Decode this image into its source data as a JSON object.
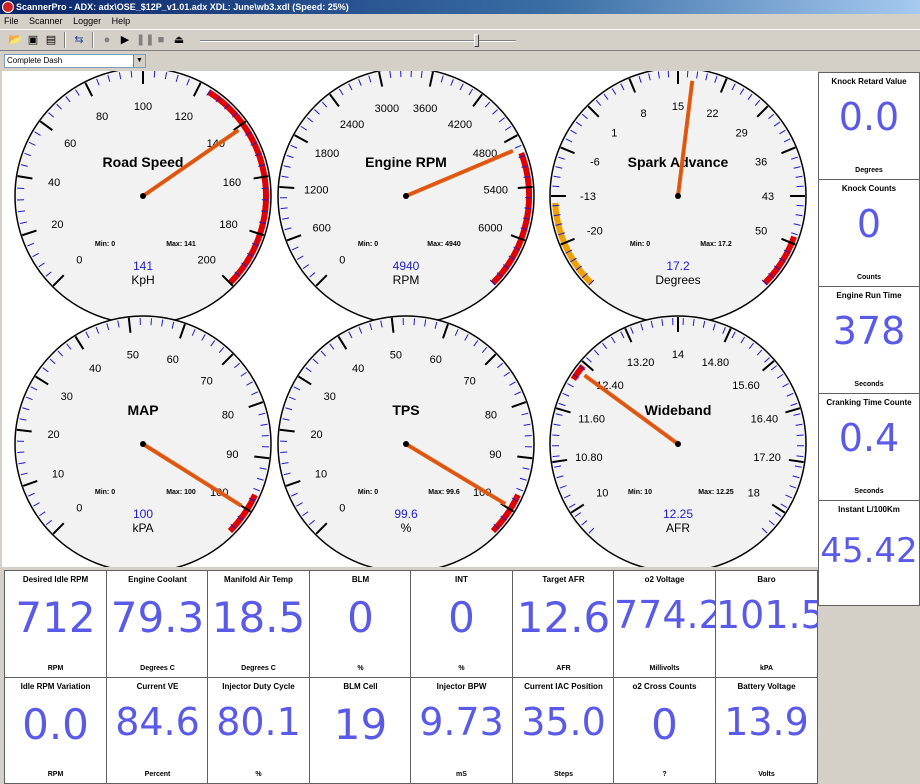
{
  "window": {
    "title": "ScannerPro - ADX: adx\\OSE_$12P_v1.01.adx  XDL: June\\wb3.xdl (Speed: 25%)"
  },
  "menu": {
    "file": "File",
    "scanner": "Scanner",
    "logger": "Logger",
    "help": "Help"
  },
  "toolbar": {
    "playback_speed_percent": 25
  },
  "dashboard_select": {
    "value": "Complete Dash"
  },
  "gauges": [
    {
      "id": "road-speed",
      "title": "Road Speed",
      "min": 0,
      "max": 200,
      "step": 20,
      "labels": [
        0,
        20,
        40,
        60,
        80,
        100,
        120,
        140,
        160,
        180,
        200
      ],
      "value_text": "141",
      "unit": "KpH",
      "min_text": "Min: 0",
      "max_text": "Max: 141",
      "needle": 141,
      "peak": 141,
      "zones": [
        {
          "from": 124,
          "to": 200,
          "color": "#e00000"
        }
      ]
    },
    {
      "id": "engine-rpm",
      "title": "Engine RPM",
      "min": 0,
      "max": 6600,
      "step": 600,
      "labels": [
        0,
        600,
        1200,
        1800,
        2400,
        3000,
        3600,
        4200,
        4800,
        5400,
        6000
      ],
      "value_text": "4940",
      "unit": "RPM",
      "min_text": "Min: 0",
      "max_text": "Max: 4940",
      "needle": 4940,
      "peak": 4940,
      "zones": [
        {
          "from": 5000,
          "to": 6600,
          "color": "#e00000"
        }
      ]
    },
    {
      "id": "spark-advance",
      "title": "Spark Advance",
      "min": -27,
      "max": 57,
      "step": 7,
      "labels": [
        -20,
        -13,
        -6,
        1,
        8,
        15,
        22,
        29,
        36,
        43,
        50
      ],
      "value_text": "17.2",
      "unit": "Degrees",
      "min_text": "Min: 0",
      "max_text": "Max: 17.2",
      "needle": 17.2,
      "peak": 17.2,
      "zones": [
        {
          "from": -27,
          "to": -14,
          "color": "#f0a000"
        },
        {
          "from": 49,
          "to": 57,
          "color": "#e00000"
        }
      ]
    },
    {
      "id": "map",
      "title": "MAP",
      "min": 0,
      "max": 105,
      "step": 10,
      "labels": [
        0,
        10,
        20,
        30,
        40,
        50,
        60,
        70,
        80,
        90,
        100
      ],
      "value_text": "100",
      "unit": "kPA",
      "min_text": "Min: 0",
      "max_text": "Max: 100",
      "needle": 100,
      "peak": 100,
      "zones": [
        {
          "from": 97,
          "to": 105,
          "color": "#e00000"
        }
      ]
    },
    {
      "id": "tps",
      "title": "TPS",
      "min": 0,
      "max": 105,
      "step": 10,
      "labels": [
        0,
        10,
        20,
        30,
        40,
        50,
        60,
        70,
        80,
        90,
        100
      ],
      "value_text": "99.6",
      "unit": "%",
      "min_text": "Min: 0",
      "max_text": "Max: 99.6",
      "needle": 99.6,
      "peak": 99.6,
      "zones": [
        {
          "from": 97,
          "to": 105,
          "color": "#e00000"
        }
      ]
    },
    {
      "id": "wideband",
      "title": "Wideband",
      "min": 9.6,
      "max": 18.4,
      "step": 0.8,
      "labels": [
        "10",
        "10.80",
        "11.60",
        "12.40",
        "13.20",
        "14",
        "14.80",
        "15.60",
        "16.40",
        "17.20",
        "18"
      ],
      "value_text": "12.25",
      "unit": "AFR",
      "min_text": "Min: 10",
      "max_text": "Max: 12.25",
      "needle": 12.25,
      "peak": 12.25,
      "zones": [
        {
          "from": 12.1,
          "to": 12.35,
          "color": "#e00000"
        }
      ]
    }
  ],
  "side_readouts": [
    {
      "label": "Knock Retard Value",
      "value": "0.0",
      "unit": "Degrees"
    },
    {
      "label": "Knock Counts",
      "value": "0",
      "unit": "Counts"
    },
    {
      "label": "Engine Run Time",
      "value": "378",
      "unit": "Seconds"
    },
    {
      "label": "Cranking Time Counte",
      "value": "0.4",
      "unit": "Seconds"
    },
    {
      "label": "Instant L/100Km",
      "value": "45.42",
      "unit": ""
    }
  ],
  "bottom_readouts_row1": [
    {
      "label": "Desired Idle RPM",
      "value": "712",
      "unit": "RPM"
    },
    {
      "label": "Engine Coolant",
      "value": "79.3",
      "unit": "Degrees C"
    },
    {
      "label": "Manifold Air Temp",
      "value": "18.5",
      "unit": "Degrees C"
    },
    {
      "label": "BLM",
      "value": "0",
      "unit": "%"
    },
    {
      "label": "INT",
      "value": "0",
      "unit": "%"
    },
    {
      "label": "Target AFR",
      "value": "12.6",
      "unit": "AFR"
    },
    {
      "label": "o2 Voltage",
      "value": "774.2",
      "unit": "Millivolts"
    },
    {
      "label": "Baro",
      "value": "101.5",
      "unit": "kPA"
    }
  ],
  "bottom_readouts_row2": [
    {
      "label": "Idle RPM Variation",
      "value": "0.0",
      "unit": "RPM"
    },
    {
      "label": "Current VE",
      "value": "84.6",
      "unit": "Percent"
    },
    {
      "label": "Injector Duty Cycle",
      "value": "80.1",
      "unit": "%"
    },
    {
      "label": "BLM Cell",
      "value": "19",
      "unit": ""
    },
    {
      "label": "Injector BPW",
      "value": "9.73",
      "unit": "mS"
    },
    {
      "label": "Current IAC Position",
      "value": "35.0",
      "unit": "Steps"
    },
    {
      "label": "o2 Cross Counts",
      "value": "0",
      "unit": "?"
    },
    {
      "label": "Battery Voltage",
      "value": "13.9",
      "unit": "Volts"
    }
  ]
}
